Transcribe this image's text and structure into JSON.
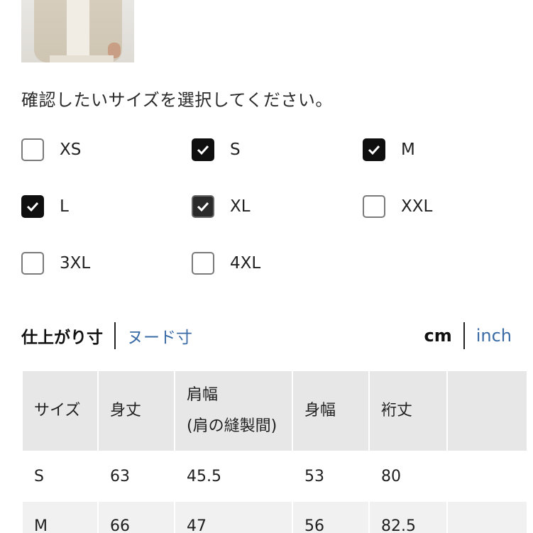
{
  "prompt": "確認したいサイズを選択してください。",
  "sizes": [
    {
      "label": "XS",
      "checked": false
    },
    {
      "label": "S",
      "checked": true
    },
    {
      "label": "M",
      "checked": true
    },
    {
      "label": "L",
      "checked": true
    },
    {
      "label": "XL",
      "checked": true
    },
    {
      "label": "XXL",
      "checked": false
    },
    {
      "label": "3XL",
      "checked": false
    },
    {
      "label": "4XL",
      "checked": false
    }
  ],
  "measure_tabs": {
    "finished": "仕上がり寸",
    "nude": "ヌード寸"
  },
  "unit_tabs": {
    "cm": "cm",
    "inch": "inch"
  },
  "table": {
    "headers": [
      "サイズ",
      "身丈",
      "肩幅",
      "(肩の縫製間)",
      "身幅",
      "裄丈"
    ],
    "rows": [
      [
        "S",
        "63",
        "45.5",
        "53",
        "80",
        ""
      ],
      [
        "M",
        "66",
        "47",
        "56",
        "82.5",
        ""
      ]
    ]
  },
  "colors": {
    "link": "#3a6ba6",
    "checkbox_checked": "#0f0f0f",
    "header_bg": "#e7e7e7"
  }
}
